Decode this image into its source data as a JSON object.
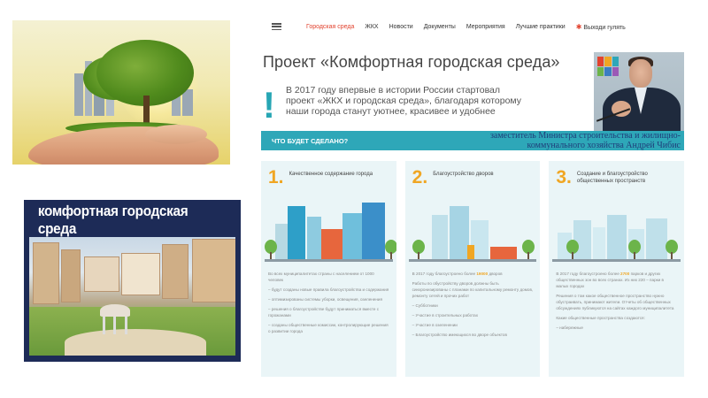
{
  "hand_image": {
    "alt": ""
  },
  "banner": {
    "title": "комфортная городская среда"
  },
  "site": {
    "nav": {
      "menu_icon": "hamburger-menu-icon",
      "items": [
        {
          "label": "Городская среда",
          "active": true
        },
        {
          "label": "ЖКХ",
          "active": false
        },
        {
          "label": "Новости",
          "active": false
        },
        {
          "label": "Документы",
          "active": false
        },
        {
          "label": "Мероприятия",
          "active": false
        },
        {
          "label": "Лучшие практики",
          "active": false
        },
        {
          "label": "Выходи гулять",
          "active": false,
          "icon": "walk-icon"
        }
      ]
    },
    "project_title": "Проект «Комфортная городская среда»",
    "intro_text": "В 2017 году впервые в истории России стартовал проект «ЖКХ и городская среда», благодаря которому наши города станут уютнее, красивее и удобнее",
    "band_title": "ЧТО БУДЕТ СДЕЛАНО?",
    "portrait_caption": "заместитель Министра строительства и жилищно-коммунального хозяйства Андрей Чибис",
    "columns": [
      {
        "num": "1.",
        "label": "Качественное содержание города",
        "paragraphs": [
          "Во всех муниципалитетах страны с населением от 1000 человек",
          "– будут созданы новые правила благоустройства и содержания",
          "– оптимизированы системы уборки, освещения, озеленения",
          "– решения о благоустройстве будут приниматься вместе с горожанами",
          "– созданы общественные комиссии, контролирующие решения о развитии города"
        ]
      },
      {
        "num": "2.",
        "label": "Благоустройство дворов",
        "lead_before": "В 2017 году благоустроено более",
        "lead_bold": "19000",
        "lead_after": "дворов",
        "paragraphs": [
          "Работы по обустройству дворов должны быть синхронизированы с планами по капитальному ремонту домов, ремонту сетей и прочих работ",
          "– Субботники",
          "– Участие в строительных работах",
          "– Участие в озеленении",
          "– Благоустройство имеющихся во дворе объектов"
        ]
      },
      {
        "num": "3.",
        "label": "Создание и благоустройство общественных пространств",
        "lead_before": "В 2017 году благоустроено более",
        "lead_bold": "2700",
        "lead_after": "парков и других общественных зон во всех странах. Из них 220 – парки в малых городах",
        "paragraphs": [
          "Решения о том какое общественное пространство нужно обустраивать, принимают жители. Отчеты об общественных обсуждениях публикуются на сайтах каждого муниципалитета",
          "Какие общественные пространства создаются:",
          "– набережные"
        ]
      }
    ]
  },
  "colors": {
    "accent_red": "#e2432f",
    "teal": "#2ea7b8",
    "orange": "#f0a623",
    "caption_blue": "#1f3e7a"
  }
}
